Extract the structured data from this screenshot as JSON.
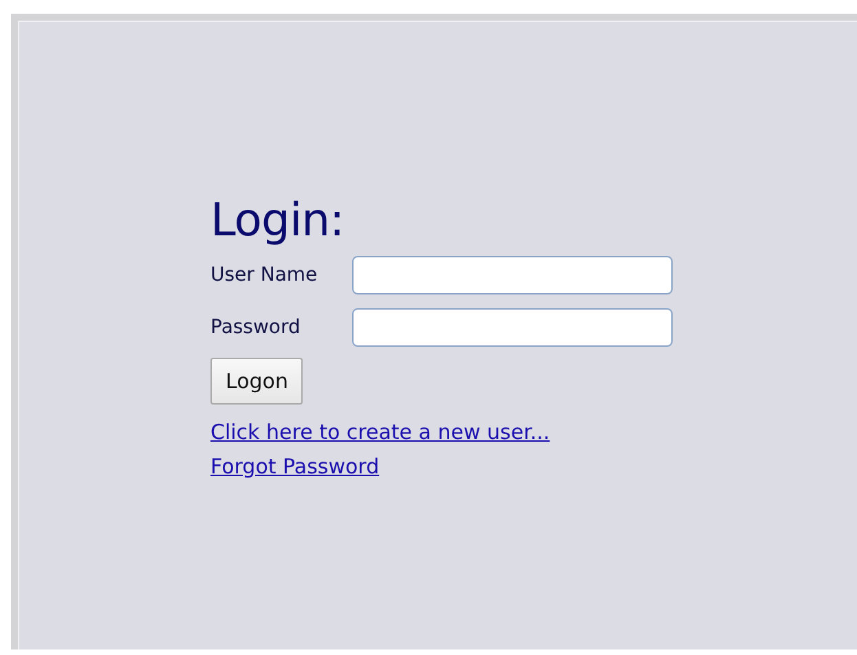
{
  "title": "Login:",
  "fields": [
    {
      "label": "User Name"
    },
    {
      "label": "Password"
    }
  ],
  "button": "Logon",
  "links": [
    "Click here to create a new user...",
    "Forgot Password"
  ]
}
